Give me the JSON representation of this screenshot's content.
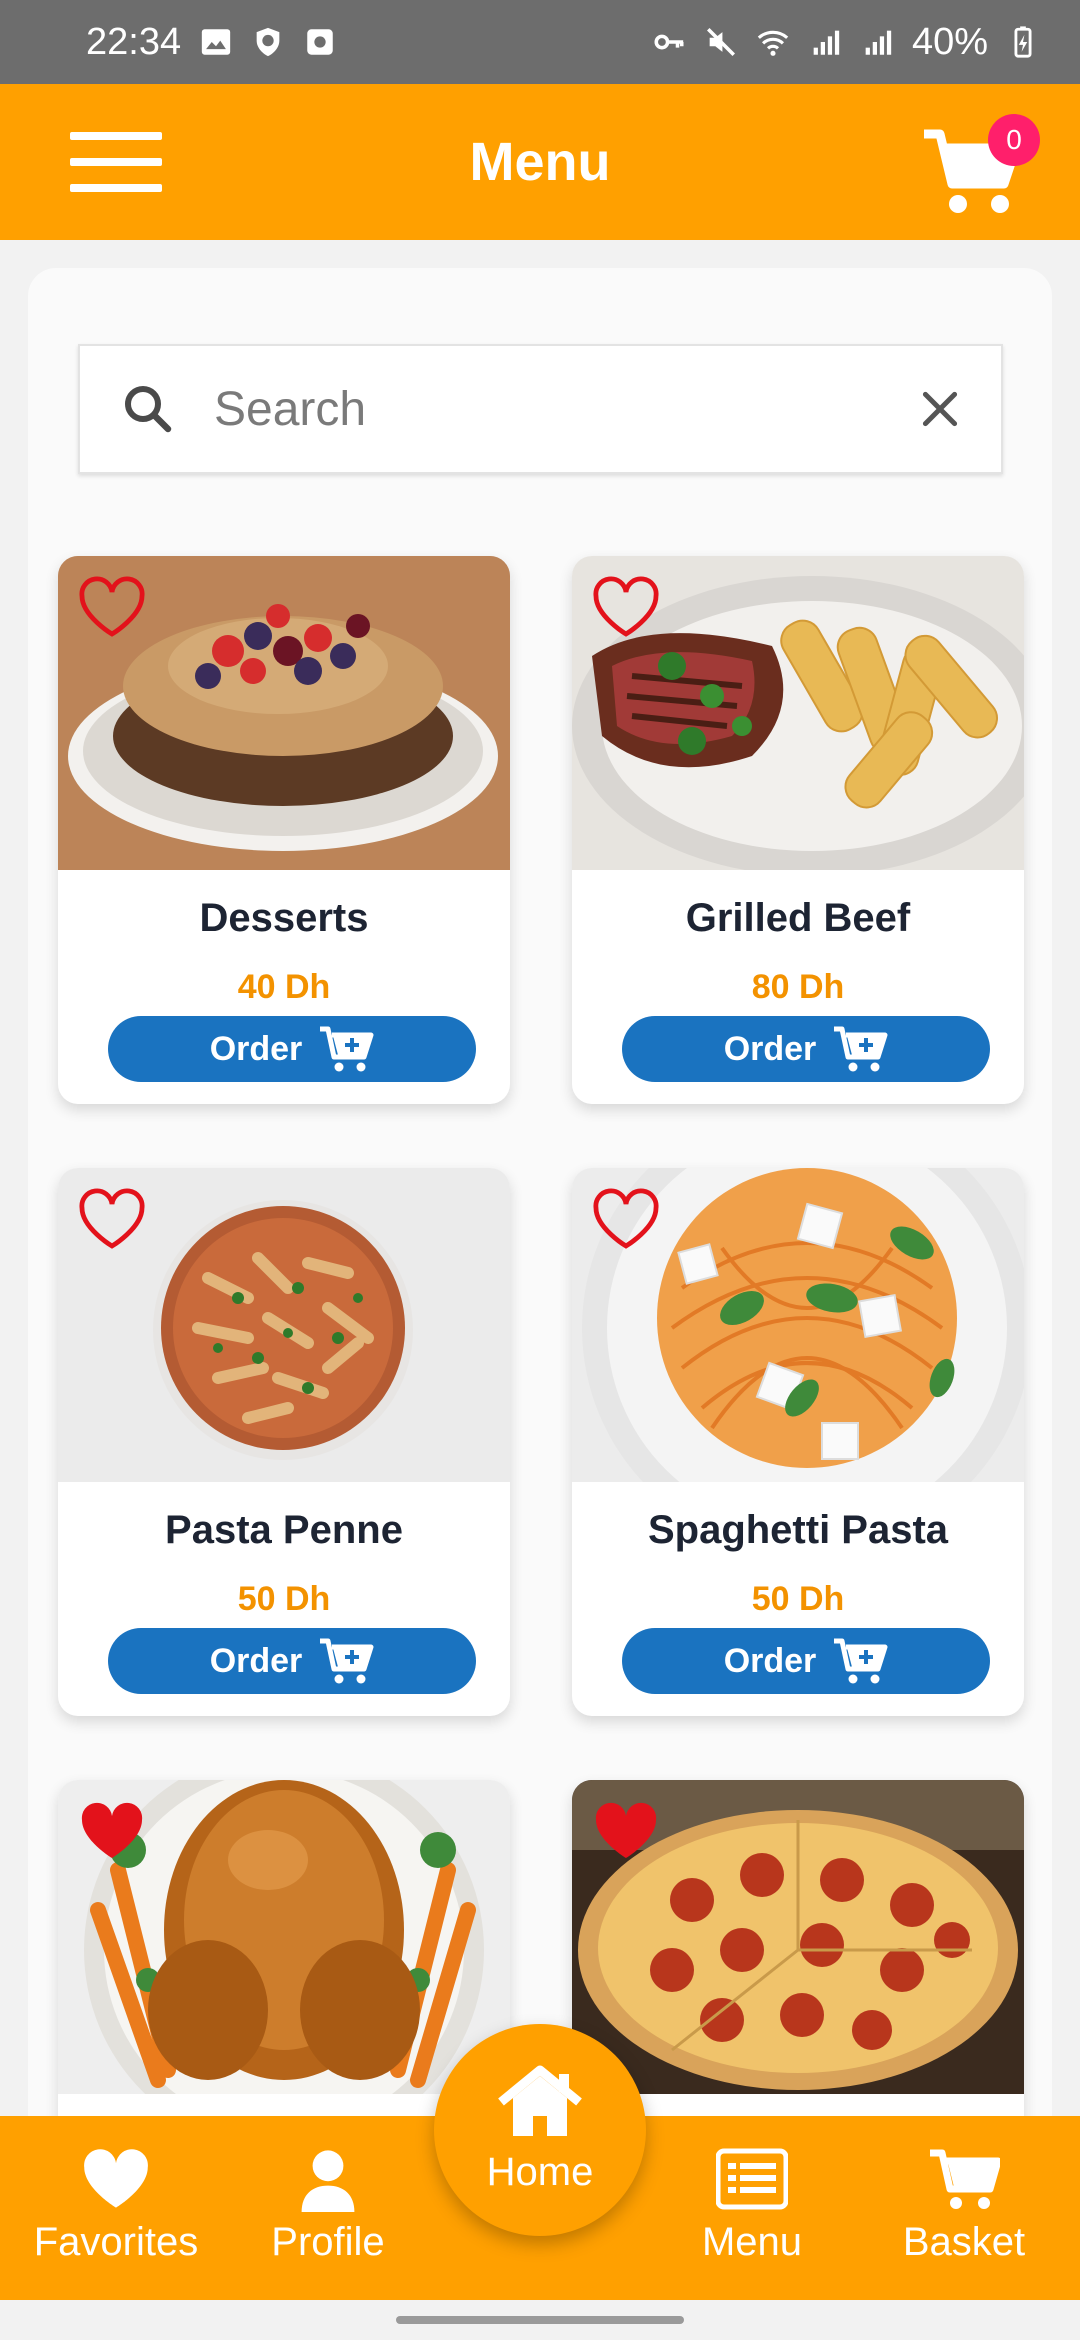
{
  "status_bar": {
    "time": "22:34",
    "battery": "40%"
  },
  "header": {
    "title": "Menu",
    "cart_count": "0"
  },
  "search": {
    "placeholder": "Search",
    "value": ""
  },
  "colors": {
    "primary": "#ffa000",
    "order_button": "#1a73c0",
    "price": "#f39200",
    "heart": "#e3121b",
    "badge": "#ff1f6b"
  },
  "items": [
    {
      "name": "Desserts",
      "price": "40 Dh",
      "order_label": "Order",
      "favorite": false,
      "image_icon": "cake-image"
    },
    {
      "name": "Grilled Beef",
      "price": "80 Dh",
      "order_label": "Order",
      "favorite": false,
      "image_icon": "steak-image"
    },
    {
      "name": "Pasta Penne",
      "price": "50 Dh",
      "order_label": "Order",
      "favorite": false,
      "image_icon": "penne-image"
    },
    {
      "name": "Spaghetti Pasta",
      "price": "50 Dh",
      "order_label": "Order",
      "favorite": false,
      "image_icon": "spaghetti-image"
    },
    {
      "name": "",
      "price": "",
      "order_label": "",
      "favorite": true,
      "image_icon": "roast-chicken-image"
    },
    {
      "name": "",
      "price": "",
      "order_label": "",
      "favorite": true,
      "image_icon": "pizza-image"
    }
  ],
  "bottom_nav": {
    "favorites": "Favorites",
    "profile": "Profile",
    "home": "Home",
    "menu": "Menu",
    "basket": "Basket"
  }
}
